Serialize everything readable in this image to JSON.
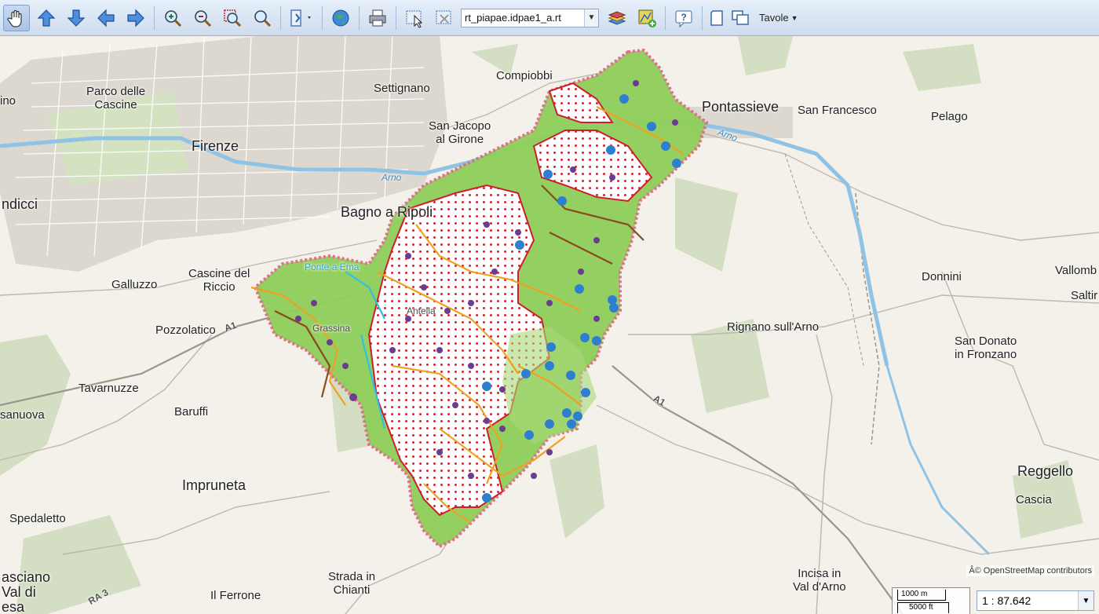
{
  "toolbar": {
    "buttons": [
      {
        "name": "pan-tool-button",
        "icon": "hand-icon"
      },
      {
        "name": "pan-up-button",
        "icon": "arrow-up-icon"
      },
      {
        "name": "pan-down-button",
        "icon": "arrow-down-icon"
      },
      {
        "name": "pan-left-button",
        "icon": "arrow-left-icon"
      },
      {
        "name": "pan-right-button",
        "icon": "arrow-right-icon"
      },
      {
        "name": "zoom-in-button",
        "icon": "zoom-in-icon"
      },
      {
        "name": "zoom-out-button",
        "icon": "zoom-out-icon"
      },
      {
        "name": "zoom-box-button",
        "icon": "zoom-box-icon"
      },
      {
        "name": "zoom-extent-button",
        "icon": "magnifier-icon"
      },
      {
        "name": "identify-button",
        "icon": "identify-icon"
      },
      {
        "name": "globe-button",
        "icon": "globe-icon"
      },
      {
        "name": "print-button",
        "icon": "printer-icon"
      },
      {
        "name": "select-feature-button",
        "icon": "select-icon"
      },
      {
        "name": "clear-selection-button",
        "icon": "deselect-icon"
      }
    ],
    "layer_select_value": "rt_piapae.idpae1_a.rt",
    "after_buttons": [
      {
        "name": "layers-button",
        "icon": "layers-icon"
      },
      {
        "name": "add-layer-button",
        "icon": "add-layer-icon"
      },
      {
        "name": "help-button",
        "icon": "help-icon"
      },
      {
        "name": "legend-button",
        "icon": "document-icon"
      },
      {
        "name": "windows-button",
        "icon": "windows-icon"
      }
    ],
    "tavole_label": "Tavole"
  },
  "map": {
    "labels": [
      {
        "text": "Parco delle\nCascine",
        "size": "normal"
      },
      {
        "text": "Firenze",
        "size": "big"
      },
      {
        "text": "Settignano",
        "size": "normal"
      },
      {
        "text": "Compiobbi",
        "size": "normal"
      },
      {
        "text": "San Jacopo\nal Girone",
        "size": "normal"
      },
      {
        "text": "Pontassieve",
        "size": "big"
      },
      {
        "text": "San Francesco",
        "size": "normal"
      },
      {
        "text": "Pelago",
        "size": "normal"
      },
      {
        "text": "ndicci",
        "size": "big"
      },
      {
        "text": "Bagno a Ripoli",
        "size": "big"
      },
      {
        "text": "Galluzzo",
        "size": "normal"
      },
      {
        "text": "Cascine del\nRiccio",
        "size": "normal"
      },
      {
        "text": "Pozzolatico",
        "size": "normal"
      },
      {
        "text": "Rignano sull'Arno",
        "size": "normal"
      },
      {
        "text": "Donnini",
        "size": "normal"
      },
      {
        "text": "Vallomb",
        "size": "normal"
      },
      {
        "text": "Saltir",
        "size": "normal"
      },
      {
        "text": "San Donato\nin Fronzano",
        "size": "normal"
      },
      {
        "text": "Tavarnuzze",
        "size": "normal"
      },
      {
        "text": "Baruffi",
        "size": "normal"
      },
      {
        "text": "sanuova",
        "size": "normal"
      },
      {
        "text": "Impruneta",
        "size": "big"
      },
      {
        "text": "Reggello",
        "size": "big"
      },
      {
        "text": "Cascia",
        "size": "normal"
      },
      {
        "text": "Spedaletto",
        "size": "normal"
      },
      {
        "text": "asciano\nVal di\nesa",
        "size": "big"
      },
      {
        "text": "Il Ferrone",
        "size": "normal"
      },
      {
        "text": "Strada in\nChianti",
        "size": "normal"
      },
      {
        "text": "Incisa in\nVal d'Arno",
        "size": "normal"
      },
      {
        "text": "Antella",
        "size": "normal"
      },
      {
        "text": "Ponte a Ema",
        "size": "normal"
      },
      {
        "text": "A1",
        "size": "normal"
      },
      {
        "text": "A1",
        "size": "normal"
      },
      {
        "text": "RA 3",
        "size": "normal"
      },
      {
        "text": "Arno",
        "size": "normal"
      },
      {
        "text": "Arno",
        "size": "normal"
      },
      {
        "text": "Grassina",
        "size": "normal"
      },
      {
        "text": "ino",
        "size": "normal"
      }
    ],
    "attribution": "Â© OpenStreetMap contributors",
    "scale_bar_metric": "1000 m",
    "scale_bar_imperial": "5000 ft",
    "scale_value": "1 : 87.642"
  },
  "colors": {
    "protected_area_fill": "#8fcf5a",
    "protected_area_border": "#e06a8a",
    "hatch_border": "#cc1f2a",
    "hatch_dot": "#e0202a",
    "trail_orange": "#f0a020",
    "trail_brown": "#8a4a1e",
    "poi_purple": "#6a3d8f",
    "poi_blue": "#2f7fd0",
    "river": "#8fc3e6",
    "urban": "#d9d5cd"
  }
}
